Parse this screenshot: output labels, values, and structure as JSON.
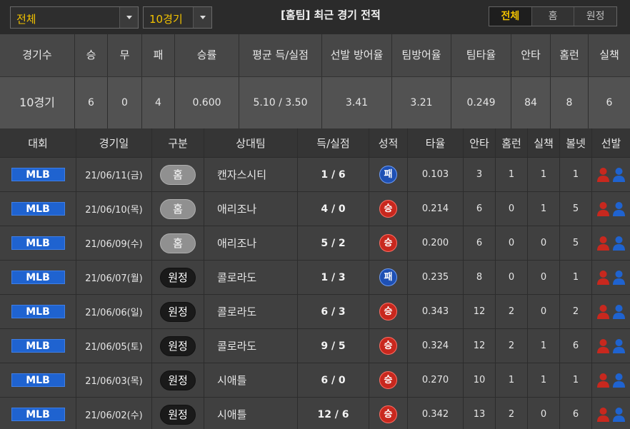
{
  "filters": {
    "scope": "전체",
    "count": "10경기"
  },
  "title": "[홈팀] 최근 경기 전적",
  "view_tabs": [
    {
      "label": "전체",
      "active": true
    },
    {
      "label": "홈",
      "active": false
    },
    {
      "label": "원정",
      "active": false
    }
  ],
  "summary": {
    "headers": [
      "경기수",
      "승",
      "무",
      "패",
      "승률",
      "평균 득/실점",
      "선발 방어율",
      "팀방어율",
      "팀타율",
      "안타",
      "홈런",
      "실책"
    ],
    "values": [
      "10경기",
      "6",
      "0",
      "4",
      "0.600",
      "5.10 / 3.50",
      "3.41",
      "3.21",
      "0.249",
      "84",
      "8",
      "6"
    ]
  },
  "games": {
    "headers": [
      "대회",
      "경기일",
      "구분",
      "상대팀",
      "득/실점",
      "성적",
      "타율",
      "안타",
      "홈런",
      "실책",
      "볼넷",
      "선발"
    ],
    "rows": [
      {
        "league": "MLB",
        "date": "21/06/11(금)",
        "venue": "홈",
        "venue_type": "home",
        "opponent": "캔자스시티",
        "score": "1 / 6",
        "result": "패",
        "result_type": "loss",
        "avg": "0.103",
        "hits": "3",
        "hr": "1",
        "errors": "1",
        "walks": "1"
      },
      {
        "league": "MLB",
        "date": "21/06/10(목)",
        "venue": "홈",
        "venue_type": "home",
        "opponent": "애리조나",
        "score": "4 / 0",
        "result": "승",
        "result_type": "win",
        "avg": "0.214",
        "hits": "6",
        "hr": "0",
        "errors": "1",
        "walks": "5"
      },
      {
        "league": "MLB",
        "date": "21/06/09(수)",
        "venue": "홈",
        "venue_type": "home",
        "opponent": "애리조나",
        "score": "5 / 2",
        "result": "승",
        "result_type": "win",
        "avg": "0.200",
        "hits": "6",
        "hr": "0",
        "errors": "0",
        "walks": "5"
      },
      {
        "league": "MLB",
        "date": "21/06/07(월)",
        "venue": "원정",
        "venue_type": "away",
        "opponent": "콜로라도",
        "score": "1 / 3",
        "result": "패",
        "result_type": "loss",
        "avg": "0.235",
        "hits": "8",
        "hr": "0",
        "errors": "0",
        "walks": "1"
      },
      {
        "league": "MLB",
        "date": "21/06/06(일)",
        "venue": "원정",
        "venue_type": "away",
        "opponent": "콜로라도",
        "score": "6 / 3",
        "result": "승",
        "result_type": "win",
        "avg": "0.343",
        "hits": "12",
        "hr": "2",
        "errors": "0",
        "walks": "2"
      },
      {
        "league": "MLB",
        "date": "21/06/05(토)",
        "venue": "원정",
        "venue_type": "away",
        "opponent": "콜로라도",
        "score": "9 / 5",
        "result": "승",
        "result_type": "win",
        "avg": "0.324",
        "hits": "12",
        "hr": "2",
        "errors": "1",
        "walks": "6"
      },
      {
        "league": "MLB",
        "date": "21/06/03(목)",
        "venue": "원정",
        "venue_type": "away",
        "opponent": "시애틀",
        "score": "6 / 0",
        "result": "승",
        "result_type": "win",
        "avg": "0.270",
        "hits": "10",
        "hr": "1",
        "errors": "1",
        "walks": "1"
      },
      {
        "league": "MLB",
        "date": "21/06/02(수)",
        "venue": "원정",
        "venue_type": "away",
        "opponent": "시애틀",
        "score": "12 / 6",
        "result": "승",
        "result_type": "win",
        "avg": "0.342",
        "hits": "13",
        "hr": "2",
        "errors": "0",
        "walks": "6"
      }
    ]
  },
  "icons": {
    "home_pitcher": "red-person-icon",
    "away_pitcher": "blue-person-icon"
  },
  "colors": {
    "accent": "#f2c200",
    "league_badge": "#1f63d0",
    "win": "#c8281e",
    "loss": "#1e50b4"
  }
}
